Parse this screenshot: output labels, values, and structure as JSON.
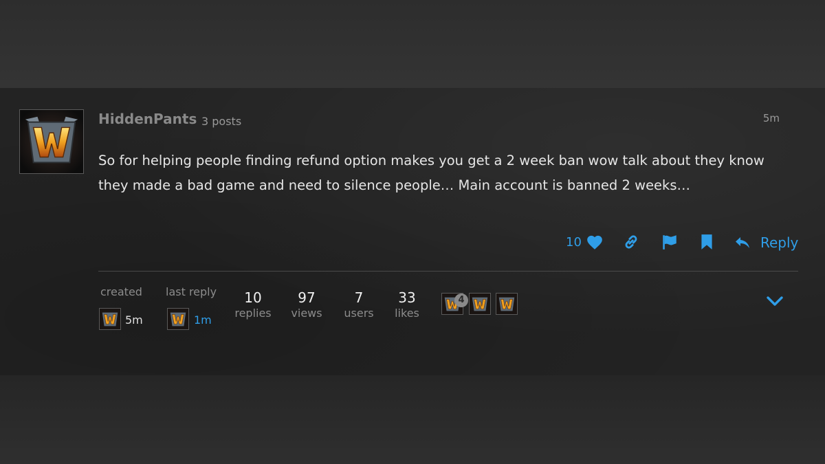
{
  "post": {
    "username": "HiddenPants",
    "post_count": "3 posts",
    "age": "5m",
    "body": "So for helping people finding refund option makes you get a 2 week ban wow talk about they know they made a bad game and need to silence people… Main account is banned 2 weeks…",
    "avatar_icon": "warcraft-w-logo"
  },
  "actions": {
    "like_count": "10",
    "like_icon": "heart-icon",
    "link_icon": "link-icon",
    "flag_icon": "flag-icon",
    "bookmark_icon": "bookmark-icon",
    "reply_label": "Reply",
    "reply_icon": "reply-arrow-icon",
    "accent_color": "#2f9ee8"
  },
  "topic_map": {
    "created_label": "created",
    "created_time": "5m",
    "last_reply_label": "last reply",
    "last_reply_time": "1m",
    "stats": [
      {
        "value": "10",
        "label": "replies"
      },
      {
        "value": "97",
        "label": "views"
      },
      {
        "value": "7",
        "label": "users"
      },
      {
        "value": "33",
        "label": "likes"
      }
    ],
    "participant_badge": "4",
    "expand_icon": "chevron-down-icon"
  }
}
